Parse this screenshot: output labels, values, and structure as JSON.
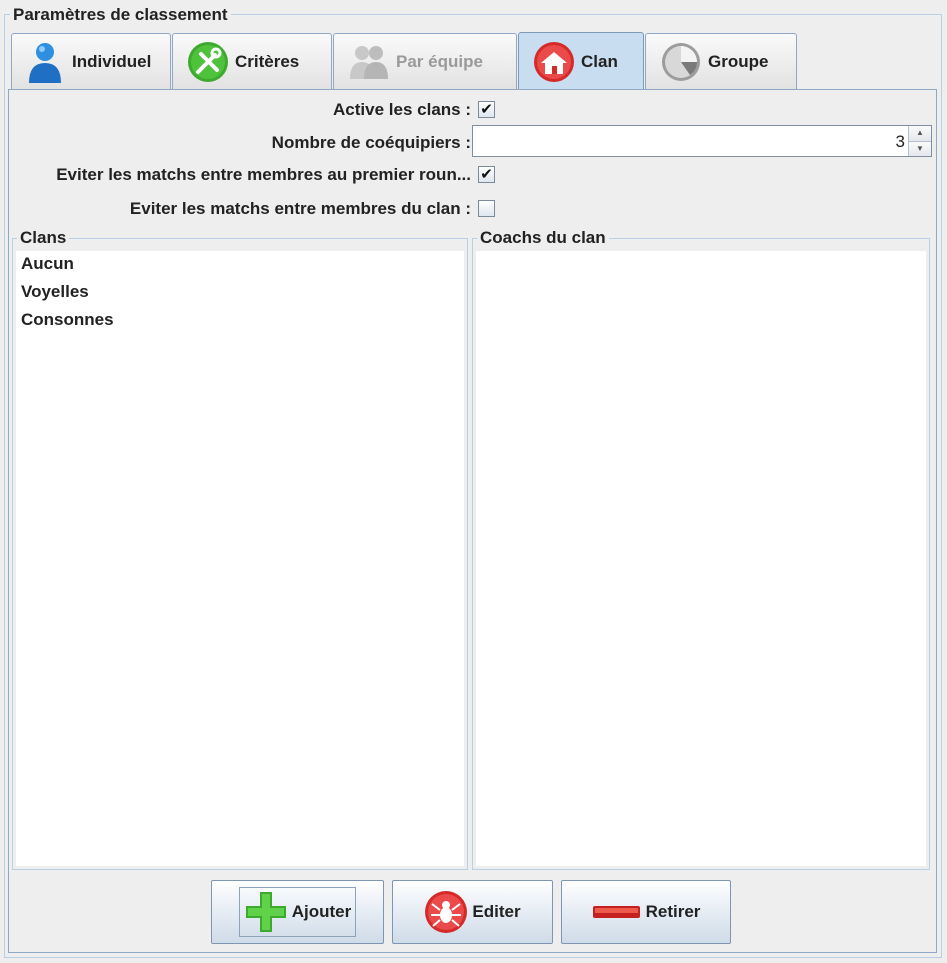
{
  "panel": {
    "title": "Paramètres de classement"
  },
  "tabs": [
    {
      "label": "Individuel",
      "icon": "person-icon",
      "state": "normal"
    },
    {
      "label": "Critères",
      "icon": "tools-icon",
      "state": "normal"
    },
    {
      "label": "Par équipe",
      "icon": "team-icon",
      "state": "disabled"
    },
    {
      "label": "Clan",
      "icon": "house-icon",
      "state": "selected"
    },
    {
      "label": "Groupe",
      "icon": "pie-icon",
      "state": "normal"
    }
  ],
  "settings": {
    "active_clans_label": "Active les clans :",
    "active_clans_checked": true,
    "teammates_label": "Nombre de coéquipiers :",
    "teammates_value": "3",
    "avoid_first_round_label": "Eviter les matchs entre membres au premier roun...",
    "avoid_first_round_checked": true,
    "avoid_clan_label": "Eviter les matchs entre membres du clan :",
    "avoid_clan_checked": false
  },
  "clans": {
    "title": "Clans",
    "items": [
      "Aucun",
      "Voyelles",
      "Consonnes"
    ]
  },
  "coaches": {
    "title": "Coachs du clan",
    "items": []
  },
  "buttons": {
    "add": "Ajouter",
    "edit": "Editer",
    "remove": "Retirer"
  },
  "colors": {
    "selected_tab": "#c9ddf0",
    "border": "#8fa8c4",
    "green_icon": "#3daa2e",
    "red_icon": "#d42a2a"
  }
}
